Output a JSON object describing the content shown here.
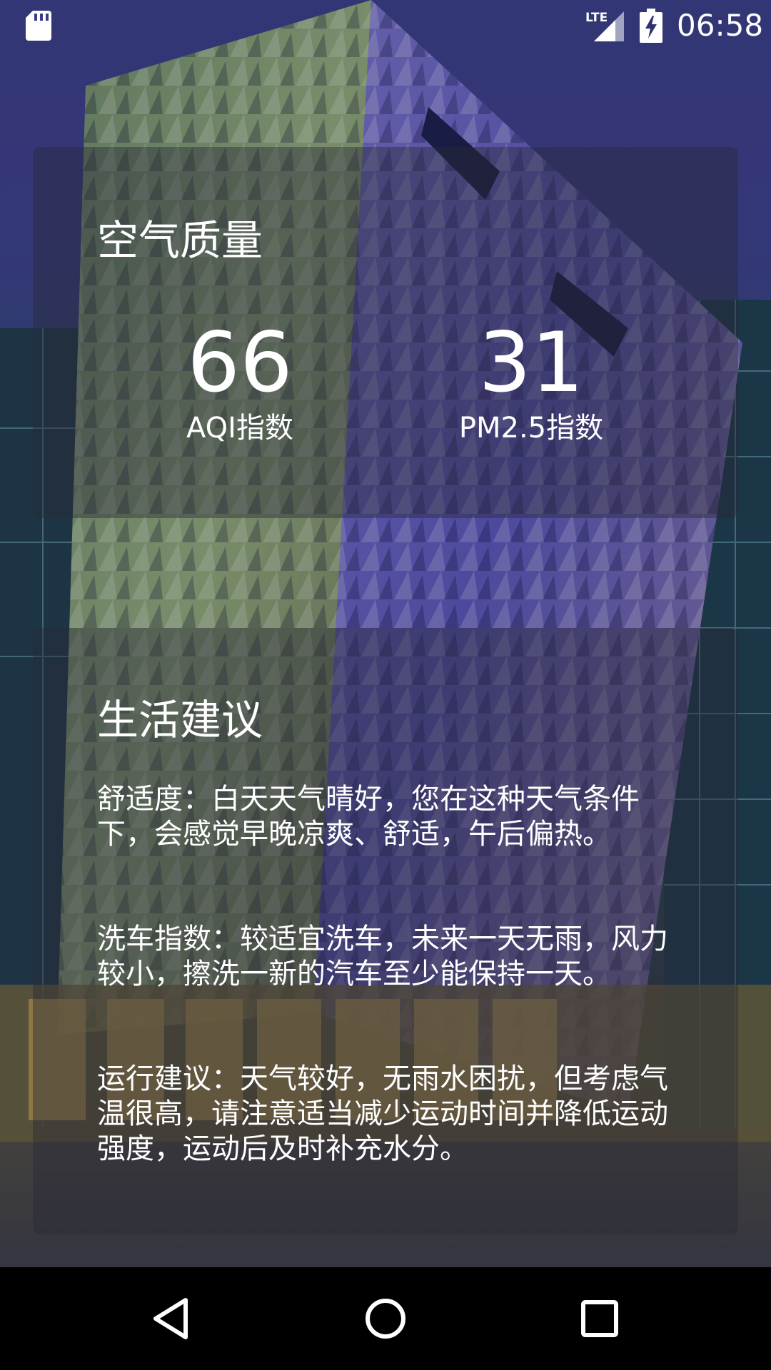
{
  "status_bar": {
    "time": "06:58",
    "network_label": "LTE",
    "icons": [
      "sd-card-icon",
      "lte-signal-icon",
      "battery-charging-icon"
    ]
  },
  "air_quality": {
    "title": "空气质量",
    "aqi": {
      "value": "66",
      "label": "AQI指数"
    },
    "pm25": {
      "value": "31",
      "label": "PM2.5指数"
    }
  },
  "life_advice": {
    "title": "生活建议",
    "comfort": "舒适度：白天天气晴好，您在这种天气条件下，会感觉早晚凉爽、舒适，午后偏热。",
    "car_wash": "洗车指数：较适宜洗车，未来一天无雨，风力较小，擦洗一新的汽车至少能保持一天。",
    "sport": "运行建议：天气较好，无雨水困扰，但考虑气温很高，请注意适当减少运动时间并降低运动强度，运动后及时补充水分。"
  },
  "nav_bar": {
    "icons": [
      "back-icon",
      "home-icon",
      "recents-icon"
    ]
  },
  "colors": {
    "card_overlay": "rgba(40,40,55,0.42)",
    "text": "#ffffff",
    "nav_background": "#000000"
  }
}
